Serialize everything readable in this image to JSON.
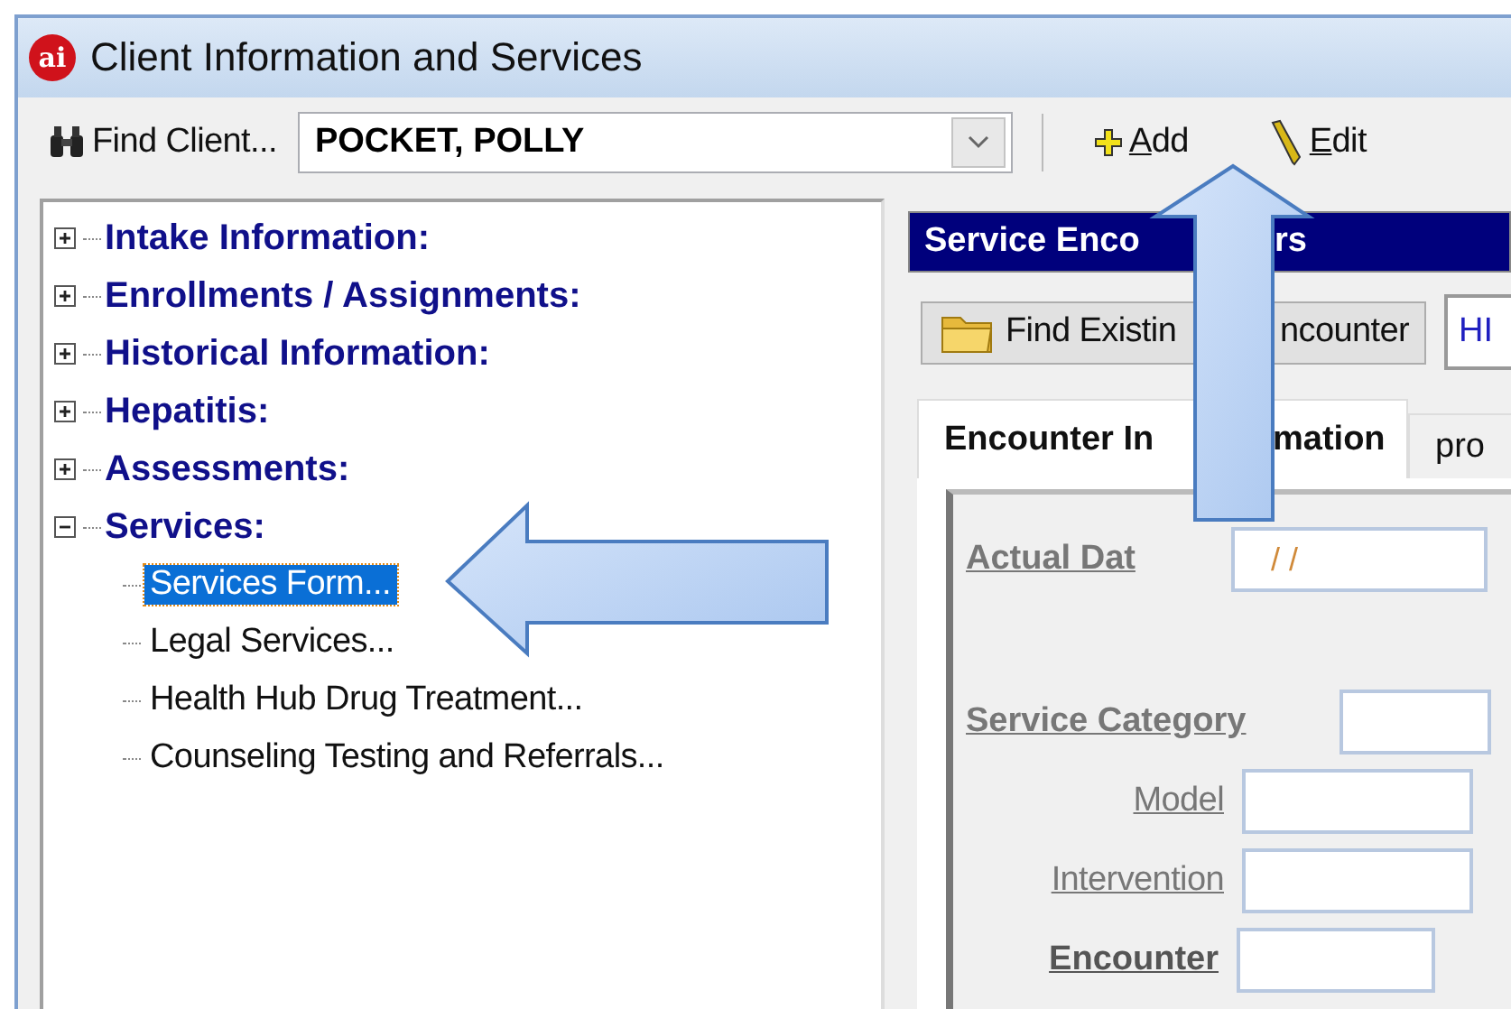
{
  "window": {
    "logo": "ai",
    "title": "Client Information and Services"
  },
  "toolbar": {
    "find_button": "Find Client...",
    "client": "POCKET, POLLY",
    "buttons": [
      {
        "kind": "add",
        "label": "Add"
      },
      {
        "kind": "edit",
        "label": "Edit"
      }
    ]
  },
  "tree": [
    {
      "label": "Intake Information:",
      "expanded": false
    },
    {
      "label": "Enrollments / Assignments:",
      "expanded": false
    },
    {
      "label": "Historical Information:",
      "expanded": false
    },
    {
      "label": "Hepatitis:",
      "expanded": false
    },
    {
      "label": "Assessments:",
      "expanded": false
    },
    {
      "label": "Services:",
      "expanded": true,
      "children": [
        {
          "label": "Services Form...",
          "selected": true
        },
        {
          "label": "Legal Services...",
          "selected": false
        },
        {
          "label": "Health Hub Drug Treatment...",
          "selected": false
        },
        {
          "label": "Counseling Testing and Referrals...",
          "selected": false
        }
      ]
    }
  ],
  "panel": {
    "header": [
      "Service Enco",
      "rs"
    ],
    "find_button": [
      "Find Existin",
      "ncounter"
    ],
    "program_field": "HI",
    "tabs": [
      {
        "label": [
          "Encounter In",
          "mation"
        ],
        "selected": true
      },
      {
        "label": [
          "pro"
        ],
        "selected": false
      }
    ],
    "fields": [
      {
        "label": "Actual Dat",
        "kind": "required",
        "value": "/ /"
      },
      {
        "label": "Service Category",
        "kind": "required"
      },
      {
        "label": "Model",
        "kind": "optional"
      },
      {
        "label": "Intervention",
        "kind": "optional"
      },
      {
        "label": "Encounter",
        "kind": "key"
      }
    ]
  }
}
